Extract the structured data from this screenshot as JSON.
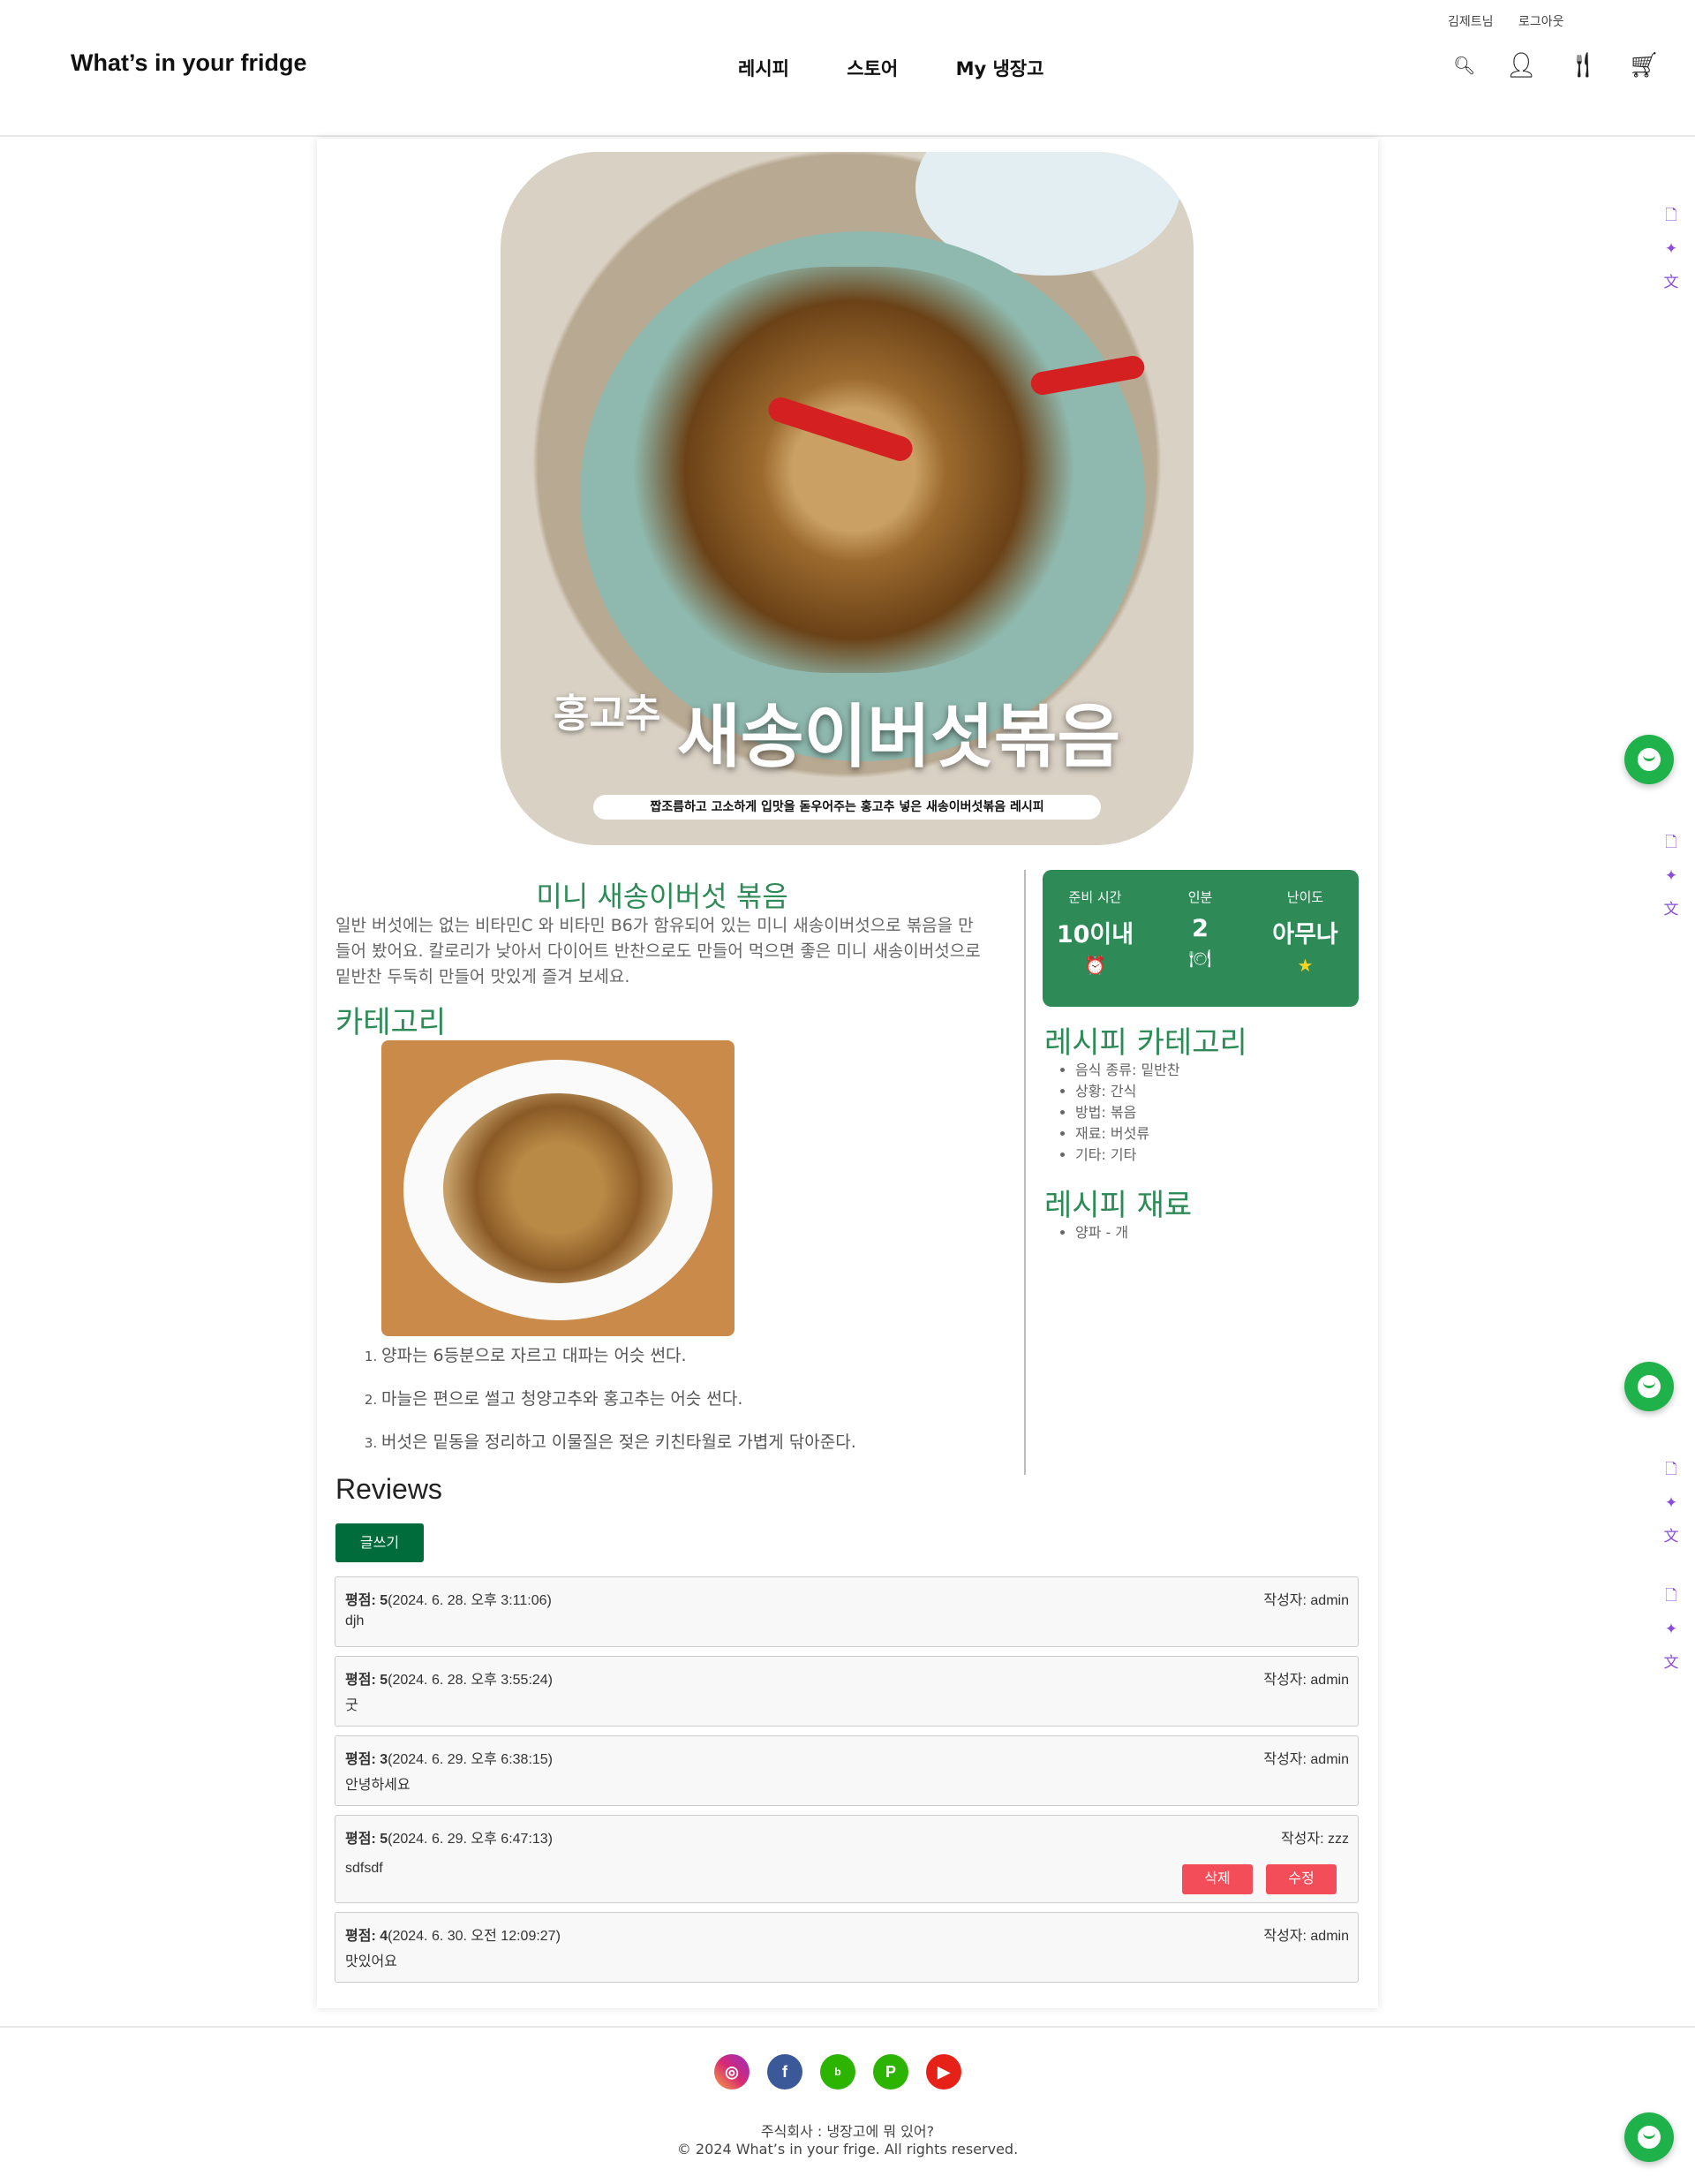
{
  "header": {
    "logo": "What’s in your fridge",
    "user_link": "김제트님",
    "logout_link": "로그아웃",
    "nav": [
      "레시피",
      "스토어",
      "My 냉장고"
    ],
    "icons": [
      "search-icon",
      "user-icon",
      "utensils-icon",
      "cart-icon"
    ]
  },
  "hero": {
    "small_title": "홍고추",
    "big_title": "새송이버섯볶음",
    "subtitle": "짭조름하고 고소하게 입맛을 돋우어주는 홍고추 넣은 새송이버섯볶음 레시피"
  },
  "recipe": {
    "title": "미니 새송이버섯 볶음",
    "description": "일반 버섯에는 없는 비타민C 와 비타민 B6가 함유되어 있는 미니 새송이버섯으로 볶음을 만들어 봤어요. 칼로리가 낮아서 다이어트 반찬으로도 만들어 먹으면 좋은 미니 새송이버섯으로 밑반찬 두둑히 만들어 맛있게 즐겨 보세요.",
    "category_heading": "카테고리",
    "steps": [
      "양파는 6등분으로 자르고 대파는 어슷 썬다.",
      "마늘은 편으로 썰고 청양고추와 홍고추는 어슷 썬다.",
      "버섯은 밑동을 정리하고 이물질은 젖은 키친타월로 가볍게 닦아준다."
    ]
  },
  "info": {
    "prep_label": "준비 시간",
    "prep_value": "10이내",
    "serving_label": "인분",
    "serving_value": "2",
    "level_label": "난이도",
    "level_value": "아무나"
  },
  "sidebar": {
    "category_heading": "레시피 카테고리",
    "categories": [
      "음식 종류: 밑반찬",
      "상황: 간식",
      "방법: 볶음",
      "재료: 버섯류",
      "기타: 기타"
    ],
    "ingredient_heading": "레시피 재료",
    "ingredients": [
      "양파 - 개"
    ]
  },
  "reviews": {
    "heading": "Reviews",
    "write_button": "글쓰기",
    "delete_button": "삭제",
    "edit_button": "수정",
    "items": [
      {
        "score_label": "평점: 5",
        "date": "(2024. 6. 28. 오후 3:11:06)",
        "author": "작성자: admin",
        "text": "djh"
      },
      {
        "score_label": "평점: 5",
        "date": "(2024. 6. 28. 오후 3:55:24)",
        "author": "작성자: admin",
        "text": "굿"
      },
      {
        "score_label": "평점: 3",
        "date": "(2024. 6. 29. 오후 6:38:15)",
        "author": "작성자: admin",
        "text": "안녕하세요"
      },
      {
        "score_label": "평점: 5",
        "date": "(2024. 6. 29. 오후 6:47:13)",
        "author": "작성자: zzz",
        "text": "sdfsdf"
      },
      {
        "score_label": "평점: 4",
        "date": "(2024. 6. 30. 오전 12:09:27)",
        "author": "작성자: admin",
        "text": "맛있어요"
      }
    ]
  },
  "footer": {
    "company": "주식회사 : 냉장고에 뭐 있어?",
    "copyright": "© 2024 What’s in your frige. All rights reserved.",
    "social": [
      "instagram-icon",
      "facebook-icon",
      "blog-icon",
      "naver-post-icon",
      "youtube-icon"
    ]
  },
  "colors": {
    "accent": "#2e8b57",
    "button": "#006c3c",
    "danger": "#f44d5a",
    "chat": "#1fb14a"
  }
}
